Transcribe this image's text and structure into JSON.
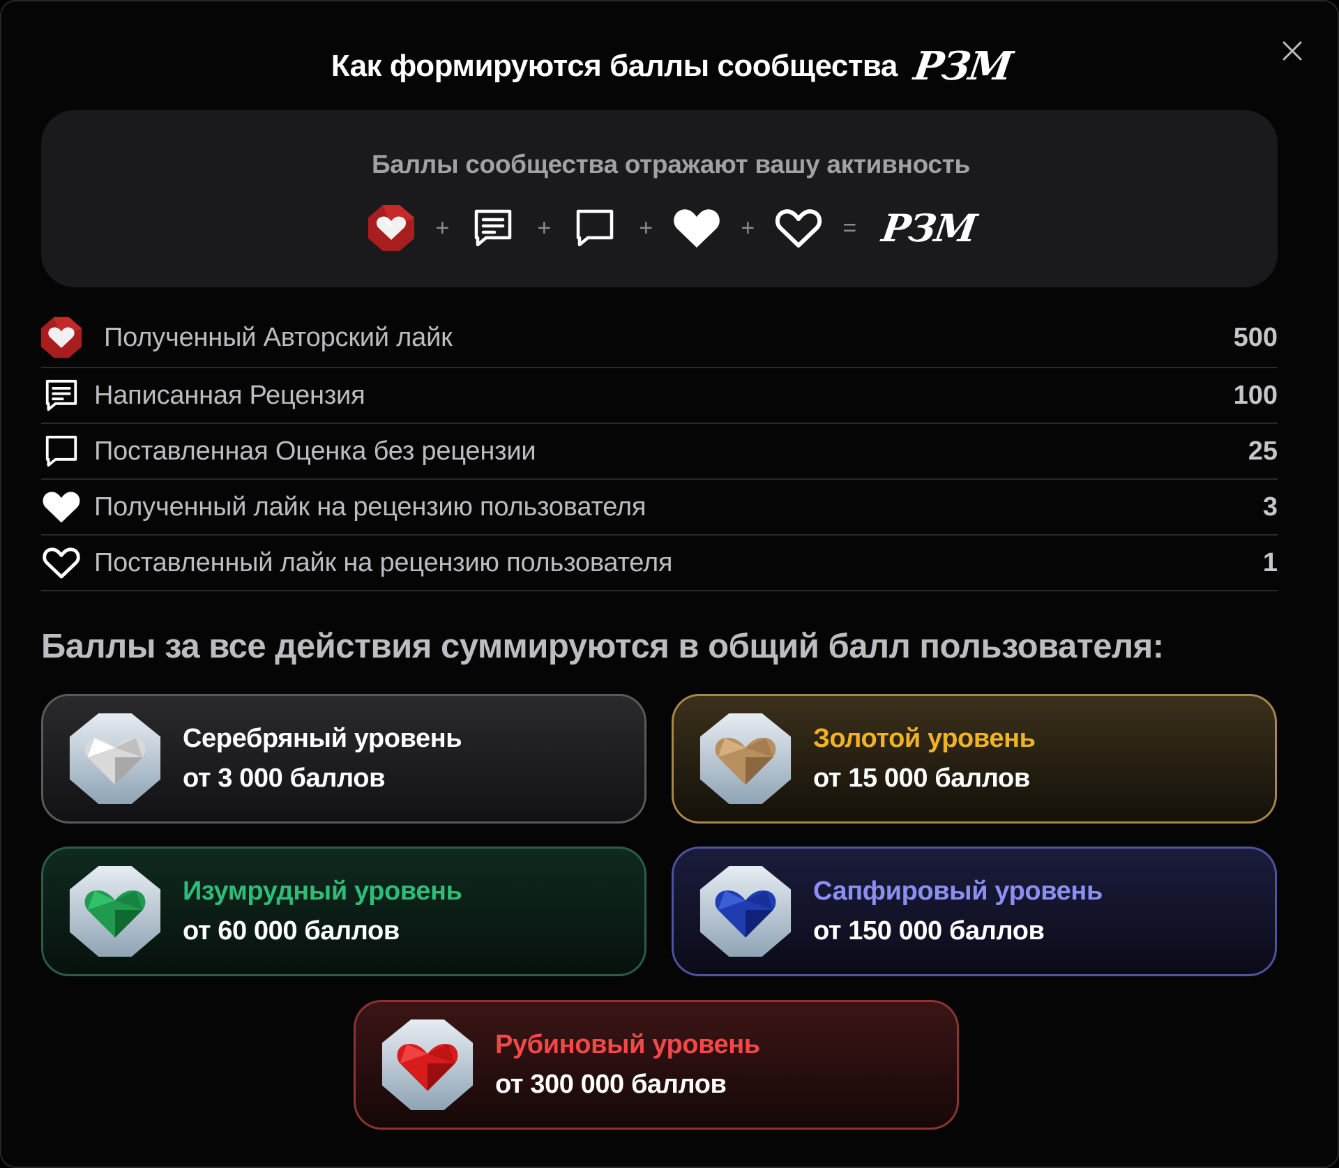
{
  "modal": {
    "title": "Как формируются баллы сообщества",
    "logo_text": "РЗМ",
    "close_icon": "close-icon"
  },
  "summary": {
    "text": "Баллы сообщества отражают вашу активность",
    "formula": {
      "plus": "+",
      "equals": "=",
      "logo_text": "РЗМ",
      "icons": [
        "author-like-icon",
        "review-icon",
        "rating-icon",
        "heart-filled-icon",
        "heart-outline-icon"
      ]
    }
  },
  "actions": [
    {
      "label": "Полученный Авторский лайк",
      "value": "500",
      "icon": "author-like-icon"
    },
    {
      "label": "Написанная Рецензия",
      "value": "100",
      "icon": "review-icon"
    },
    {
      "label": "Поставленная Оценка без рецензии",
      "value": "25",
      "icon": "rating-icon"
    },
    {
      "label": "Полученный лайк на рецензию пользователя",
      "value": "3",
      "icon": "heart-filled-icon"
    },
    {
      "label": "Поставленный лайк на рецензию пользователя",
      "value": "1",
      "icon": "heart-outline-icon"
    }
  ],
  "sum_heading": "Баллы за все действия суммируются в общий балл пользователя:",
  "levels": [
    {
      "name": "Серебряный уровень",
      "range": "от 3 000 баллов",
      "color": "#ffffff",
      "gem_color": "#d9d9d9"
    },
    {
      "name": "Золотой уровень",
      "range": "от 15 000 баллов",
      "color": "#f0b323",
      "gem_color": "#b88f5f"
    },
    {
      "name": "Изумрудный уровень",
      "range": "от 60 000 баллов",
      "color": "#2dbd77",
      "gem_color": "#1f9a4e"
    },
    {
      "name": "Сапфировый уровень",
      "range": "от 150 000 баллов",
      "color": "#8c8ff2",
      "gem_color": "#1f3db0"
    },
    {
      "name": "Рубиновый уровень",
      "range": "от 300 000 баллов",
      "color": "#f24848",
      "gem_color": "#d81c1c"
    }
  ]
}
